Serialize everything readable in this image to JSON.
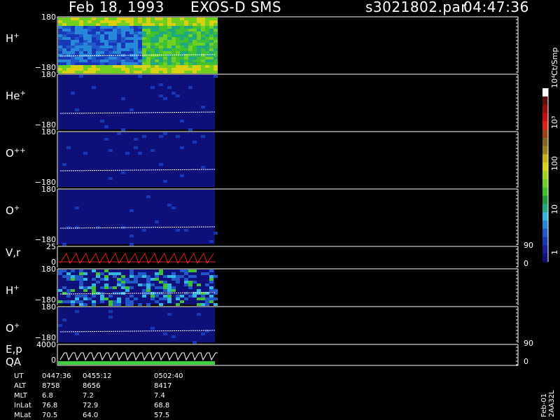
{
  "header": {
    "date": "Feb 18, 1993",
    "mission": "EXOS-D SMS",
    "file": "s3021802.par",
    "time": "04:47:36"
  },
  "chart_data": {
    "type": "heatmap",
    "panels": [
      {
        "label": "H",
        "sup": "+",
        "ymax": "180",
        "ymin": "−180",
        "style": "h1"
      },
      {
        "label": "He",
        "sup": "+",
        "ymax": "180",
        "ymin": "−180",
        "style": "dim"
      },
      {
        "label": "O",
        "sup": "++",
        "ymax": "180",
        "ymin": "−180",
        "style": "dim"
      },
      {
        "label": "O",
        "sup": "+",
        "ymax": "180",
        "ymin": "−180",
        "style": "dim"
      },
      {
        "label": "V,r",
        "sup": "",
        "ymax": "25",
        "ymin": "0",
        "right_top": "90",
        "right_bottom": "0",
        "style": "vr"
      },
      {
        "label": "H",
        "sup": "+",
        "ymax": "180",
        "ymin": "−180",
        "style": "h2"
      },
      {
        "label": "O",
        "sup": "+",
        "ymax": "180",
        "ymin": "−180",
        "style": "dim"
      },
      {
        "label": "E,p",
        "sup": "",
        "ymax": "4000",
        "ymin": "0",
        "right_top": "90",
        "right_bottom": "0",
        "style": "ep"
      }
    ],
    "qa_label": "QA",
    "colorbar": {
      "unit": "Ct/Smp",
      "ticks": [
        "1",
        "10",
        "100",
        "10³",
        "10⁴"
      ],
      "colors": [
        "#10107a",
        "#182098",
        "#1838b8",
        "#2058c8",
        "#2888d8",
        "#30b8e0",
        "#20a880",
        "#209840",
        "#40c030",
        "#70d020",
        "#a0d020",
        "#d8d010",
        "#c8b010",
        "#988020",
        "#806820",
        "#a04010",
        "#e02010",
        "#c01010",
        "#901010",
        "#601010",
        "#ffffff"
      ]
    },
    "footer": {
      "rows": [
        {
          "label": "UT",
          "values": [
            "0447:36",
            "0455:12",
            "0502:40"
          ]
        },
        {
          "label": "ALT",
          "values": [
            "8758",
            "8656",
            "8417"
          ]
        },
        {
          "label": "MLT",
          "values": [
            "6.8",
            "7.2",
            "7.4"
          ]
        },
        {
          "label": "InLat",
          "values": [
            "76.8",
            "72.9",
            "68.8"
          ]
        },
        {
          "label": "MLat",
          "values": [
            "70.5",
            "64.0",
            "57.5"
          ]
        }
      ],
      "side_text": "Feb-01 2AA32L"
    }
  }
}
